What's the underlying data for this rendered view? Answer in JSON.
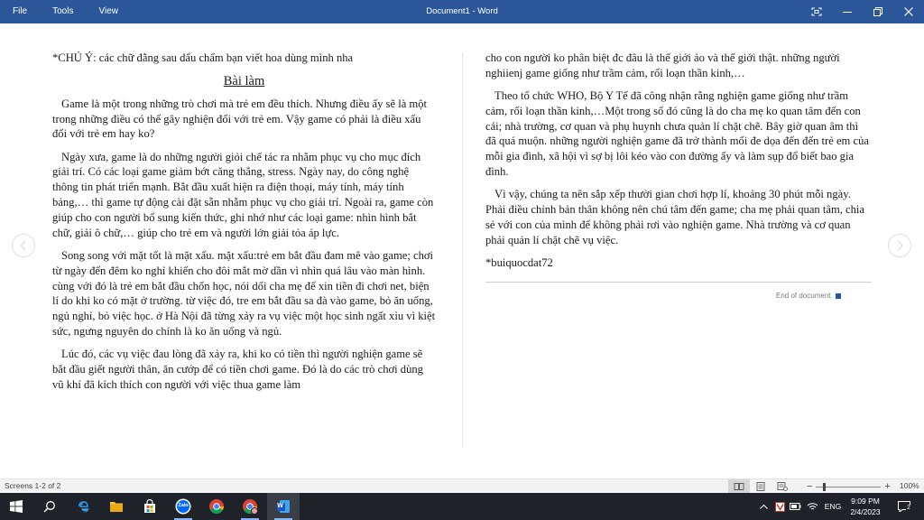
{
  "window": {
    "title": "Document1 - Word",
    "menu": [
      "File",
      "Tools",
      "View"
    ]
  },
  "left_column": {
    "note": "*CHÚ Ý: các chữ đằng sau dấu chấm bạn viết hoa dùng mình nha",
    "heading": "Bài làm",
    "paragraphs": [
      "Game là một trong những trò chơi mà trẻ em đều thích. Nhưng điều ấy sẽ là một trong những điều có thể gây nghiện đối với trẻ em. Vậy game có phải là điều xấu đối với trẻ em hay ko?",
      "Ngày xưa, game là do những người giỏi chế tác ra nhằm phục vụ cho mục đích giải trí. Có các loại game giảm bớt căng thẳng, stress. Ngày nay, do công nghệ thông tin phát triển mạnh. Bắt đầu xuất hiện ra điện thoại, máy tính, máy tính bảng,… thì game tự động cài đặt sẵn nhằm phục vụ cho giải trí. Ngoài ra, game còn giúp cho con người bổ sung kiến thức, ghi nhớ như các loại game: nhìn hình bắt chữ, giải ô chữ,… giúp cho trẻ em và người lớn giải tỏa áp lực.",
      "Song song với mặt tốt là mặt xấu. mặt xấu:trẻ em bắt đầu đam mê vào game; chơi từ ngày đến đêm ko nghỉ khiến cho đôi mắt mờ dần vì nhìn quá lâu vào màn hình. cùng với đó là trẻ em bắt đầu chốn học, nói dối cha mẹ để xin tiền đi chơi net, biện lí do khi ko có mặt ở trường. từ việc đó, tre em bắt đầu sa đà vào game, bỏ ăn uống, ngủ nghỉ, bỏ việc học. ở Hà Nội đã từng xảy ra vụ việc một học sinh ngất xỉu vì kiệt sức, ngưng nguyên do chính là ko ăn uống và ngủ.",
      "Lúc đó, các vụ việc đau lòng đã xảy ra, khi ko có tiền thì người nghiện game sẽ bắt đầu giết người thân, ăn cướp để có tiền chơi game. Đó là do các trò chơi dùng vũ khí đã kích thích con người với việc thua game làm"
    ]
  },
  "right_column": {
    "paragraphs": [
      "cho con người ko phân biệt đc đâu là thế giới ảo và thế giới thật. những người nghiienj game giống như trầm cảm, rối loạn thần kinh,…",
      "Theo tổ chức WHO, Bộ Y Tế đã công nhận rằng nghiện game giống như trầm cảm, rối loạn thần kinh,…Một trong số đó cũng là do cha mẹ ko quan tâm đến con cái; nhà trường, cơ quan và phụ huynh chưa quản lí chặt chẽ. Bây giờ quan âm thì đã quá muộn. những người nghiện game đã trở thành mối đe dọa đến đến trẻ em của mỗi gia đình, xã hội vì sợ bị lôi kéo vào con đường ấy và làm sụp đổ biết bao gia đình.",
      "Vì vậy, chúng ta nên sắp xếp thười gian chơi hợp lí, khoảng 30 phút mỗi ngày. Phải điều chỉnh bản thân không nên chú tâm đến game; cha mẹ phải quan tâm, chia sẻ với con của mình để không phải rơi vào nghiện game. Nhà trường và cơ quan phải quản lí chặt chẽ vụ việc.",
      "*buiquocdat72"
    ],
    "end_of_document": "End of document"
  },
  "status_bar": {
    "screens": "Screens 1-2 of 2",
    "zoom": "100%"
  },
  "taskbar": {
    "lang": "ENG",
    "time": "9:09 PM",
    "date": "2/4/2023",
    "notifications": "2",
    "zalo_label": "Zalo",
    "word_glyph": "W"
  },
  "colors": {
    "titlebar": "#2b579a",
    "taskbar": "#1f2229",
    "accent": "#2b579a"
  }
}
